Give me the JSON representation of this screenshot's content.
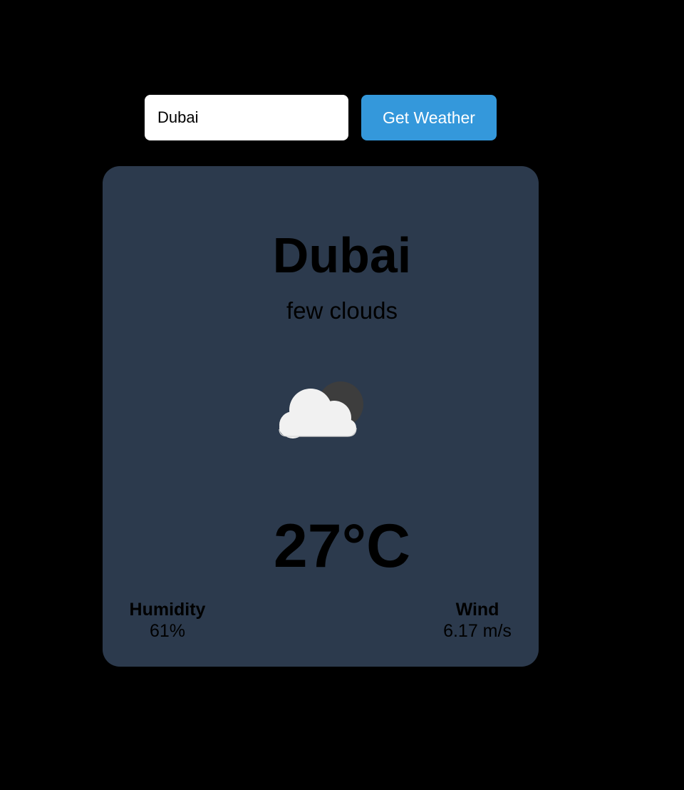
{
  "search": {
    "value": "Dubai",
    "button_label": "Get Weather"
  },
  "weather": {
    "city": "Dubai",
    "description": "few clouds",
    "icon": "few-clouds-icon",
    "temperature": "27°C",
    "humidity_label": "Humidity",
    "humidity_value": "61%",
    "wind_label": "Wind",
    "wind_value": "6.17 m/s"
  },
  "colors": {
    "background": "#000000",
    "card": "#2c3a4d",
    "button": "#3498db",
    "text": "#ecf0f1"
  }
}
